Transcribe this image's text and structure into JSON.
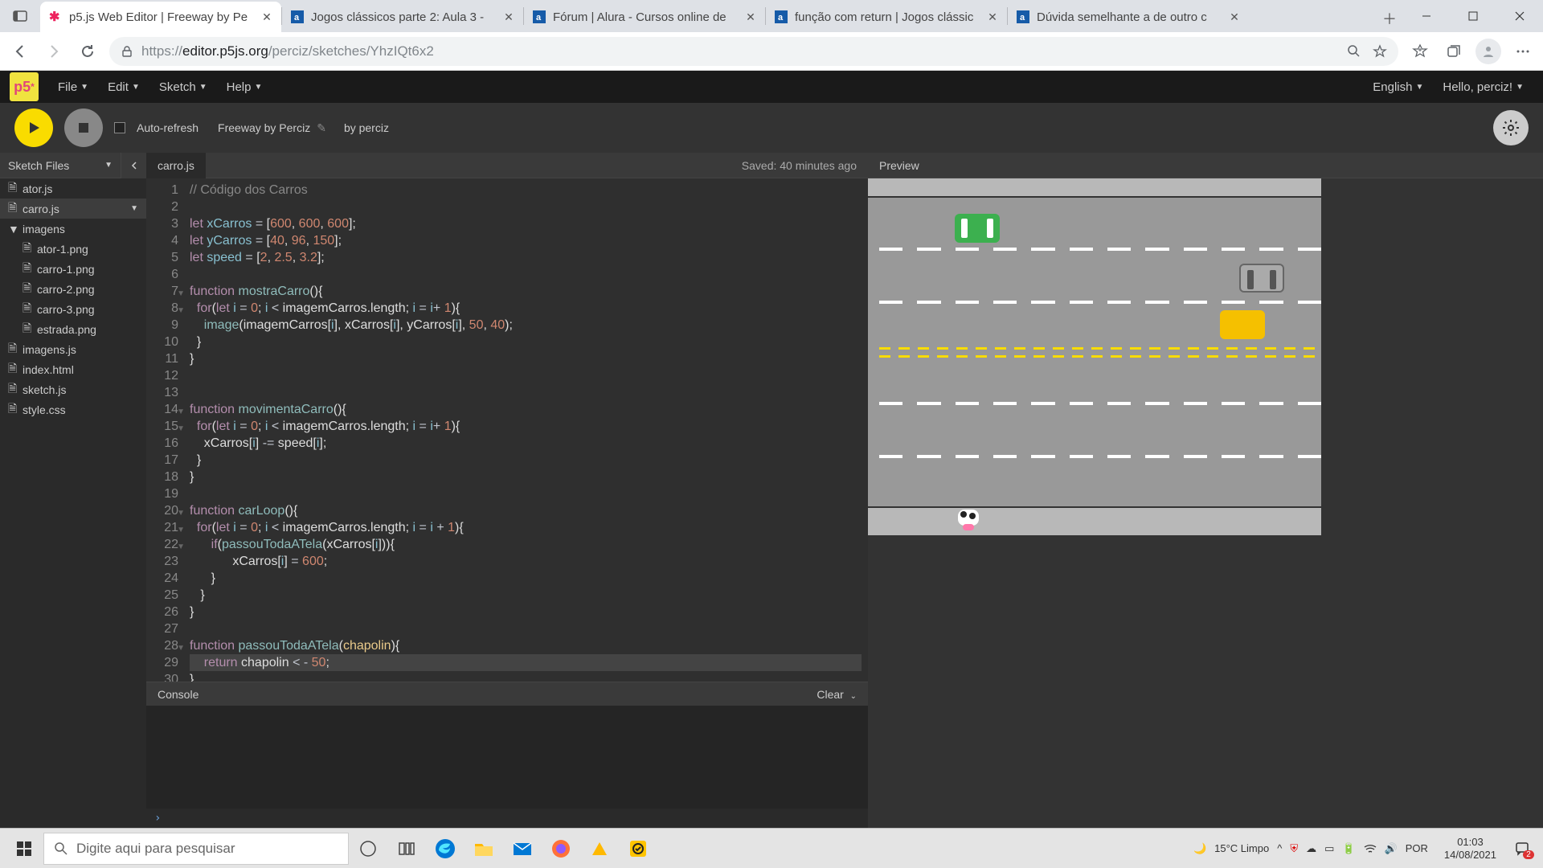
{
  "browser": {
    "tabs": [
      {
        "title": "p5.js Web Editor | Freeway by Pe",
        "active": true,
        "fav": "p5"
      },
      {
        "title": "Jogos clássicos parte 2: Aula 3 -",
        "active": false,
        "fav": "alura"
      },
      {
        "title": "Fórum | Alura - Cursos online de",
        "active": false,
        "fav": "alura"
      },
      {
        "title": "função com return | Jogos clássic",
        "active": false,
        "fav": "alura"
      },
      {
        "title": "Dúvida semelhante a de outro c",
        "active": false,
        "fav": "alura"
      }
    ],
    "url_prefix": "https://",
    "url_host": "editor.p5js.org",
    "url_path": "/perciz/sketches/YhzIQt6x2"
  },
  "p5": {
    "menus": [
      "File",
      "Edit",
      "Sketch",
      "Help"
    ],
    "lang": "English",
    "hello": "Hello, perciz!",
    "autorefresh": "Auto-refresh",
    "sketch_name": "Freeway by Perciz",
    "by": "by perciz",
    "sidebar_title": "Sketch Files",
    "files": [
      {
        "name": "ator.js",
        "indent": 0,
        "icon": "file"
      },
      {
        "name": "carro.js",
        "indent": 0,
        "icon": "file",
        "selected": true,
        "more": true
      },
      {
        "name": "imagens",
        "indent": 0,
        "icon": "folder-open"
      },
      {
        "name": "ator-1.png",
        "indent": 1,
        "icon": "file"
      },
      {
        "name": "carro-1.png",
        "indent": 1,
        "icon": "file"
      },
      {
        "name": "carro-2.png",
        "indent": 1,
        "icon": "file"
      },
      {
        "name": "carro-3.png",
        "indent": 1,
        "icon": "file"
      },
      {
        "name": "estrada.png",
        "indent": 1,
        "icon": "file"
      },
      {
        "name": "imagens.js",
        "indent": 0,
        "icon": "file"
      },
      {
        "name": "index.html",
        "indent": 0,
        "icon": "file"
      },
      {
        "name": "sketch.js",
        "indent": 0,
        "icon": "file"
      },
      {
        "name": "style.css",
        "indent": 0,
        "icon": "file"
      }
    ],
    "open_file": "carro.js",
    "saved": "Saved: 40 minutes ago",
    "preview_label": "Preview",
    "console_label": "Console",
    "clear_label": "Clear",
    "code_lines": [
      {
        "n": 1,
        "html": "<span class='cm'>// Código dos Carros</span>"
      },
      {
        "n": 2,
        "html": ""
      },
      {
        "n": 3,
        "html": "<span class='kw'>let</span> <span class='var'>xCarros</span> <span class='op'>=</span> <span class='br'>[</span><span class='num'>600</span>, <span class='num'>600</span>, <span class='num'>600</span><span class='br'>]</span>;"
      },
      {
        "n": 4,
        "html": "<span class='kw'>let</span> <span class='var'>yCarros</span> <span class='op'>=</span> <span class='br'>[</span><span class='num'>40</span>, <span class='num'>96</span>, <span class='num'>150</span><span class='br'>]</span>;"
      },
      {
        "n": 5,
        "html": "<span class='kw'>let</span> <span class='var'>speed</span> <span class='op'>=</span> <span class='br'>[</span><span class='num'>2</span>, <span class='num'>2.5</span>, <span class='num'>3.2</span><span class='br'>]</span>;"
      },
      {
        "n": 6,
        "html": ""
      },
      {
        "n": 7,
        "fold": true,
        "html": "<span class='kw'>function</span> <span class='fn'>mostraCarro</span><span class='br'>(){</span>"
      },
      {
        "n": 8,
        "fold": true,
        "html": "  <span class='kw'>for</span>(<span class='kw'>let</span> <span class='var'>i</span> <span class='op'>=</span> <span class='num'>0</span>; <span class='var'>i</span> <span class='op'>&lt;</span> imagemCarros.length; <span class='var'>i</span> <span class='op'>=</span> <span class='var'>i</span><span class='op'>+</span> <span class='num'>1</span>)<span class='br'>{</span>"
      },
      {
        "n": 9,
        "html": "    <span class='fn'>image</span>(imagemCarros[<span class='var'>i</span>], xCarros[<span class='var'>i</span>], yCarros[<span class='var'>i</span>], <span class='num'>50</span>, <span class='num'>40</span>);"
      },
      {
        "n": 10,
        "html": "  <span class='br'>}</span>"
      },
      {
        "n": 11,
        "html": "<span class='br'>}</span>"
      },
      {
        "n": 12,
        "html": ""
      },
      {
        "n": 13,
        "html": ""
      },
      {
        "n": 14,
        "fold": true,
        "html": "<span class='kw'>function</span> <span class='fn'>movimentaCarro</span><span class='br'>(){</span>"
      },
      {
        "n": 15,
        "fold": true,
        "html": "  <span class='kw'>for</span>(<span class='kw'>let</span> <span class='var'>i</span> <span class='op'>=</span> <span class='num'>0</span>; <span class='var'>i</span> <span class='op'>&lt;</span> imagemCarros.length; <span class='var'>i</span> <span class='op'>=</span> <span class='var'>i</span><span class='op'>+</span> <span class='num'>1</span>)<span class='br'>{</span>"
      },
      {
        "n": 16,
        "html": "    xCarros[<span class='var'>i</span>] <span class='op'>-=</span> speed[<span class='var'>i</span>];"
      },
      {
        "n": 17,
        "html": "  <span class='br'>}</span>"
      },
      {
        "n": 18,
        "html": "<span class='br'>}</span>"
      },
      {
        "n": 19,
        "html": ""
      },
      {
        "n": 20,
        "fold": true,
        "html": "<span class='kw'>function</span> <span class='fn'>carLoop</span><span class='br'>(){</span>"
      },
      {
        "n": 21,
        "fold": true,
        "html": "  <span class='kw'>for</span>(<span class='kw'>let</span> <span class='var'>i</span> <span class='op'>=</span> <span class='num'>0</span>; <span class='var'>i</span> <span class='op'>&lt;</span> imagemCarros.length; <span class='var'>i</span> <span class='op'>=</span> <span class='var'>i</span> <span class='op'>+</span> <span class='num'>1</span>)<span class='br'>{</span>"
      },
      {
        "n": 22,
        "fold": true,
        "html": "      <span class='kw'>if</span>(<span class='fn'>passouTodaATela</span>(xCarros[<span class='var'>i</span>]))<span class='br'>{</span>"
      },
      {
        "n": 23,
        "html": "            xCarros[<span class='var'>i</span>] <span class='op'>=</span> <span class='num'>600</span>;"
      },
      {
        "n": 24,
        "html": "      <span class='br'>}</span>"
      },
      {
        "n": 25,
        "html": "   <span class='br'>}</span>"
      },
      {
        "n": 26,
        "html": "<span class='br'>}</span>"
      },
      {
        "n": 27,
        "html": ""
      },
      {
        "n": 28,
        "fold": true,
        "html": "<span class='kw'>function</span> <span class='fn'>passouTodaATela</span><span class='br'>(</span><span class='id'>chapolin</span><span class='br'>){</span>"
      },
      {
        "n": 29,
        "hl": true,
        "html": "    <span class='kw'>return</span> chapolin <span class='op'>&lt;</span> <span class='op'>-</span> <span class='num'>50</span>;"
      },
      {
        "n": 30,
        "html": "<span class='br'>}</span>"
      }
    ]
  },
  "taskbar": {
    "search_placeholder": "Digite aqui para pesquisar",
    "weather": "15°C  Limpo",
    "lang": "POR",
    "time": "01:03",
    "date": "14/08/2021"
  }
}
